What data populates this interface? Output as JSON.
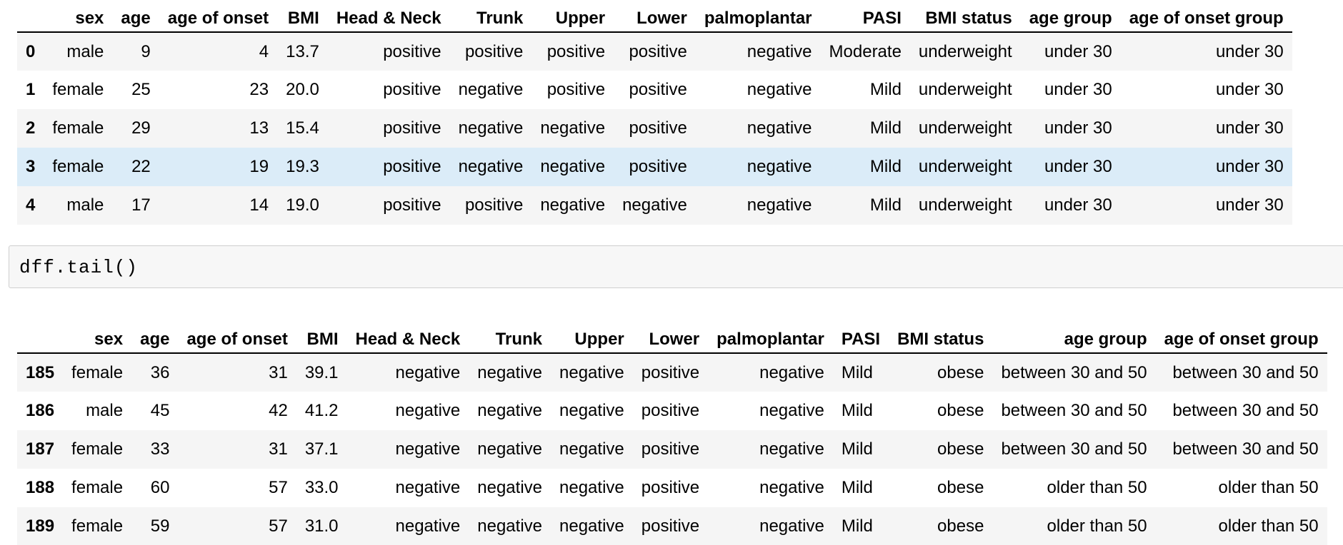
{
  "head_table": {
    "columns": [
      "sex",
      "age",
      "age of onset",
      "BMI",
      "Head & Neck",
      "Trunk",
      "Upper",
      "Lower",
      "palmoplantar",
      "PASI",
      "BMI status",
      "age group",
      "age of onset group"
    ],
    "rows": [
      {
        "index": "0",
        "cells": [
          "male",
          "9",
          "4",
          "13.7",
          "positive",
          "positive",
          "positive",
          "positive",
          "negative",
          "Moderate",
          "underweight",
          "under 30",
          "under 30"
        ]
      },
      {
        "index": "1",
        "cells": [
          "female",
          "25",
          "23",
          "20.0",
          "positive",
          "negative",
          "positive",
          "positive",
          "negative",
          "Mild",
          "underweight",
          "under 30",
          "under 30"
        ]
      },
      {
        "index": "2",
        "cells": [
          "female",
          "29",
          "13",
          "15.4",
          "positive",
          "negative",
          "negative",
          "positive",
          "negative",
          "Mild",
          "underweight",
          "under 30",
          "under 30"
        ]
      },
      {
        "index": "3",
        "cells": [
          "female",
          "22",
          "19",
          "19.3",
          "positive",
          "negative",
          "negative",
          "positive",
          "negative",
          "Mild",
          "underweight",
          "under 30",
          "under 30"
        ]
      },
      {
        "index": "4",
        "cells": [
          "male",
          "17",
          "14",
          "19.0",
          "positive",
          "positive",
          "negative",
          "negative",
          "negative",
          "Mild",
          "underweight",
          "under 30",
          "under 30"
        ]
      }
    ]
  },
  "code_cell": {
    "code": "dff.tail()"
  },
  "tail_table": {
    "columns": [
      "sex",
      "age",
      "age of onset",
      "BMI",
      "Head & Neck",
      "Trunk",
      "Upper",
      "Lower",
      "palmoplantar",
      "PASI",
      "BMI status",
      "age group",
      "age of onset group"
    ],
    "rows": [
      {
        "index": "185",
        "cells": [
          "female",
          "36",
          "31",
          "39.1",
          "negative",
          "negative",
          "negative",
          "positive",
          "negative",
          "Mild",
          "obese",
          "between 30 and 50",
          "between 30 and 50"
        ]
      },
      {
        "index": "186",
        "cells": [
          "male",
          "45",
          "42",
          "41.2",
          "negative",
          "negative",
          "negative",
          "positive",
          "negative",
          "Mild",
          "obese",
          "between 30 and 50",
          "between 30 and 50"
        ]
      },
      {
        "index": "187",
        "cells": [
          "female",
          "33",
          "31",
          "37.1",
          "negative",
          "negative",
          "negative",
          "positive",
          "negative",
          "Mild",
          "obese",
          "between 30 and 50",
          "between 30 and 50"
        ]
      },
      {
        "index": "188",
        "cells": [
          "female",
          "60",
          "57",
          "33.0",
          "negative",
          "negative",
          "negative",
          "positive",
          "negative",
          "Mild",
          "obese",
          "older than 50",
          "older than 50"
        ]
      },
      {
        "index": "189",
        "cells": [
          "female",
          "59",
          "57",
          "31.0",
          "negative",
          "negative",
          "negative",
          "positive",
          "negative",
          "Mild",
          "obese",
          "older than 50",
          "older than 50"
        ]
      }
    ]
  },
  "colors": {
    "row_odd": "#f5f5f5",
    "row_even": "#ffffff",
    "row_hover": "#dbecf8",
    "code_cell_bg": "#f7f7f7",
    "code_cell_border": "#cfcfcf"
  }
}
